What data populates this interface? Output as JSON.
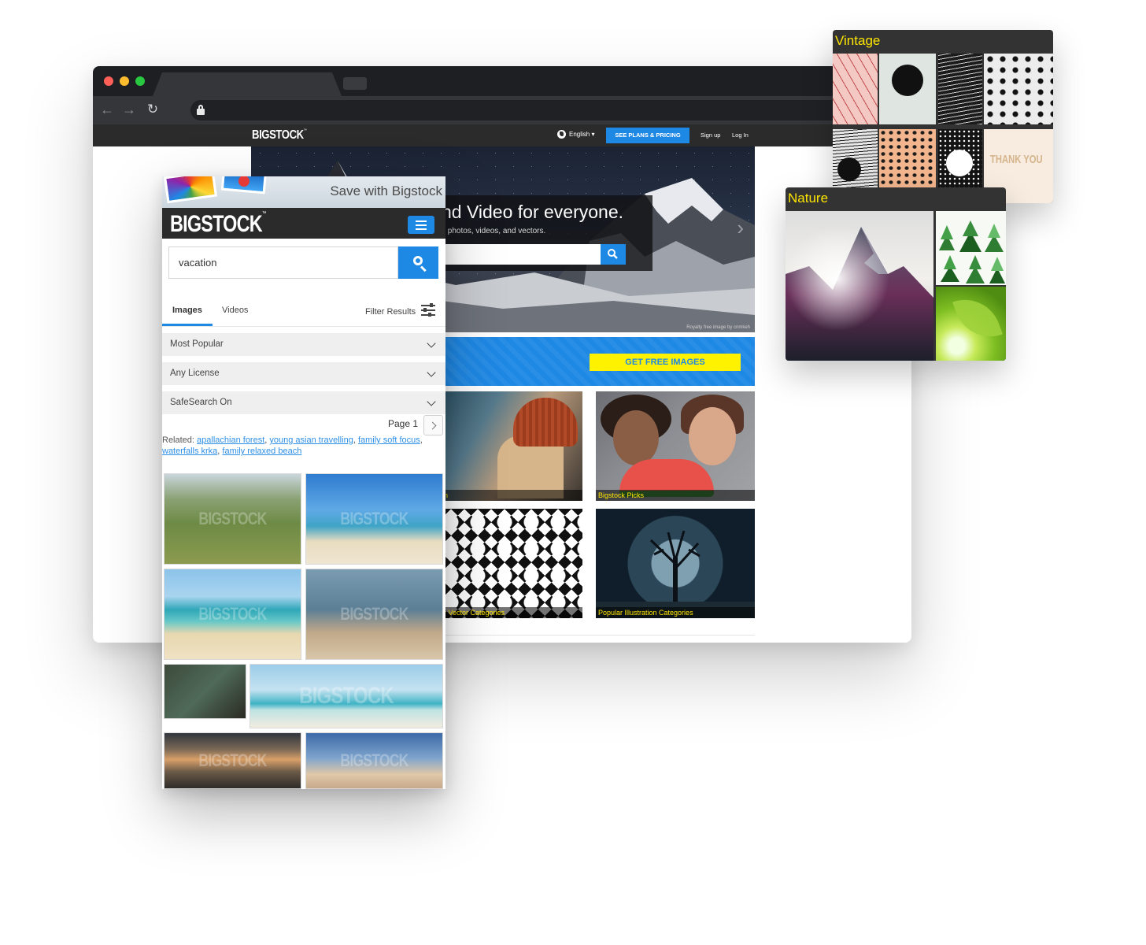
{
  "desktop": {
    "brand": "BIGSTOCK",
    "brand_tm": "™",
    "nav": {
      "language": "English ▾",
      "plans_button": "SEE PLANS & PRICING",
      "signup": "Sign up",
      "login": "Log In"
    },
    "hero": {
      "title": "nd Video for everyone.",
      "subtitle": "k photos, videos, and vectors.",
      "caption": "Royalty free image by cnmkeh"
    },
    "promo": {
      "button": "GET FREE IMAGES"
    },
    "tiles": {
      "hat": "on",
      "picks": "Bigstock Picks",
      "vector": "ar Vector Categories",
      "illustration": "Popular Illustration Categories"
    }
  },
  "mobile": {
    "banner": "Save with Bigstock",
    "brand": "BIGSTOCK",
    "brand_tm": "™",
    "search": {
      "value": "vacation"
    },
    "tabs": {
      "images": "Images",
      "videos": "Videos"
    },
    "filter": "Filter Results",
    "selects": {
      "sort": "Most Popular",
      "license": "Any License",
      "safesearch": "SafeSearch On"
    },
    "page": "Page 1",
    "related": {
      "label": "Related:",
      "links": [
        "apallachian forest",
        "young asian travelling",
        "family soft focus",
        "waterfalls krka",
        "family relaxed beach"
      ]
    },
    "watermark": "BIGSTOCK"
  },
  "collections": {
    "vintage": {
      "title": "Vintage",
      "thank_you": "THANK YOU"
    },
    "nature": {
      "title": "Nature"
    }
  },
  "colors": {
    "brand_blue": "#1e88e5",
    "promo_yellow": "#fff200",
    "header_dark": "#2b2b2b",
    "collection_title": "#ffe600"
  }
}
